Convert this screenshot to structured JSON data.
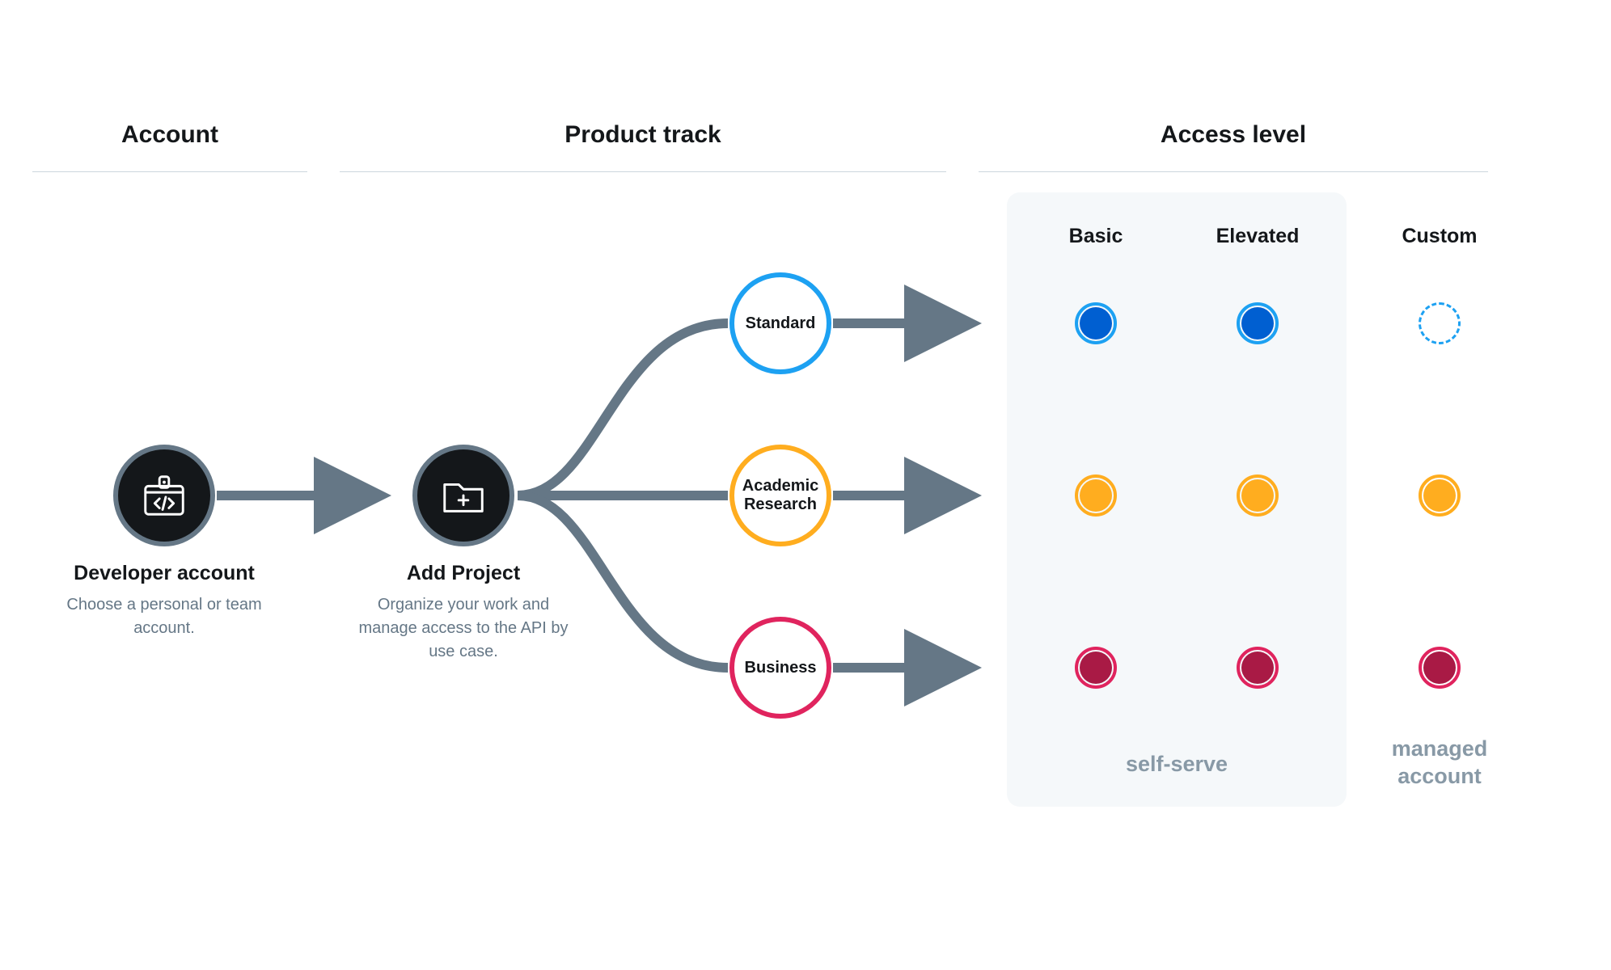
{
  "headers": {
    "account": "Account",
    "track": "Product track",
    "access": "Access level"
  },
  "nodes": {
    "developer": {
      "title": "Developer account",
      "sub": "Choose a personal or team account."
    },
    "project": {
      "title": "Add Project",
      "sub": "Organize your work and manage access to the API by use case."
    }
  },
  "tracks": {
    "standard": "Standard",
    "academic": "Academic Research",
    "business": "Business"
  },
  "access_levels": {
    "basic": "Basic",
    "elevated": "Elevated",
    "custom": "Custom"
  },
  "footer": {
    "self_serve": "self-serve",
    "managed": "managed account"
  },
  "colors": {
    "blue": "#1da1f2",
    "blue_dot": "#005fd1",
    "orange": "#ffad1f",
    "pink": "#e0245e",
    "maroon": "#a91a45",
    "gray_arrow": "#657786"
  },
  "matrix": [
    {
      "track": "standard",
      "color": "#005fd1",
      "ring": "#1da1f2",
      "basic": "solid",
      "elevated": "solid",
      "custom": "dashed-hollow"
    },
    {
      "track": "academic",
      "color": "#ffad1f",
      "ring": "#ffad1f",
      "basic": "solid",
      "elevated": "solid",
      "custom": "solid"
    },
    {
      "track": "business",
      "color": "#a91a45",
      "ring": "#e0245e",
      "basic": "solid",
      "elevated": "solid",
      "custom": "solid"
    }
  ]
}
